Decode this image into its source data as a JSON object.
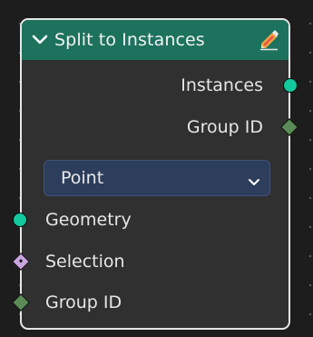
{
  "node": {
    "title": "Split to Instances",
    "header_color": "#1d725e",
    "collapse_icon": "chevron-down-icon",
    "edit_icon": "pencil-icon"
  },
  "outputs": [
    {
      "label": "Instances",
      "socket": "circle",
      "color": "#12c99d"
    },
    {
      "label": "Group ID",
      "socket": "diamond",
      "color": "#5b8c58"
    }
  ],
  "domain_select": {
    "value": "Point",
    "icon": "chevron-down-icon"
  },
  "inputs": [
    {
      "label": "Geometry",
      "socket": "circle",
      "color": "#12c99d"
    },
    {
      "label": "Selection",
      "socket": "diamond-dot",
      "color": "#c9a5dd"
    },
    {
      "label": "Group ID",
      "socket": "diamond",
      "color": "#5b8c58"
    }
  ]
}
